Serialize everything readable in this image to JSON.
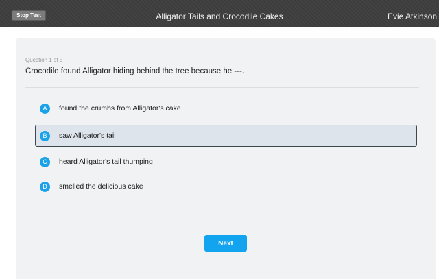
{
  "topbar": {
    "stop_label": "Stop Test",
    "title": "Alligator Tails and Crocodile Cakes",
    "user": "Evie Atkinson"
  },
  "question": {
    "counter": "Question 1 of 5",
    "text": "Crocodile found Alligator hiding behind the tree because he ---."
  },
  "options": [
    {
      "letter": "A",
      "label": "found the crumbs from Alligator's cake",
      "selected": false
    },
    {
      "letter": "B",
      "label": "saw Alligator's tail",
      "selected": true
    },
    {
      "letter": "C",
      "label": "heard Alligator's tail thumping",
      "selected": false
    },
    {
      "letter": "D",
      "label": "smelled the delicious cake",
      "selected": false
    }
  ],
  "next_label": "Next",
  "colors": {
    "topbar": "#3c3c3c",
    "accent": "#1aa1e8",
    "selected_bg": "#dde4ec",
    "card_bg": "#f1f2f4"
  }
}
